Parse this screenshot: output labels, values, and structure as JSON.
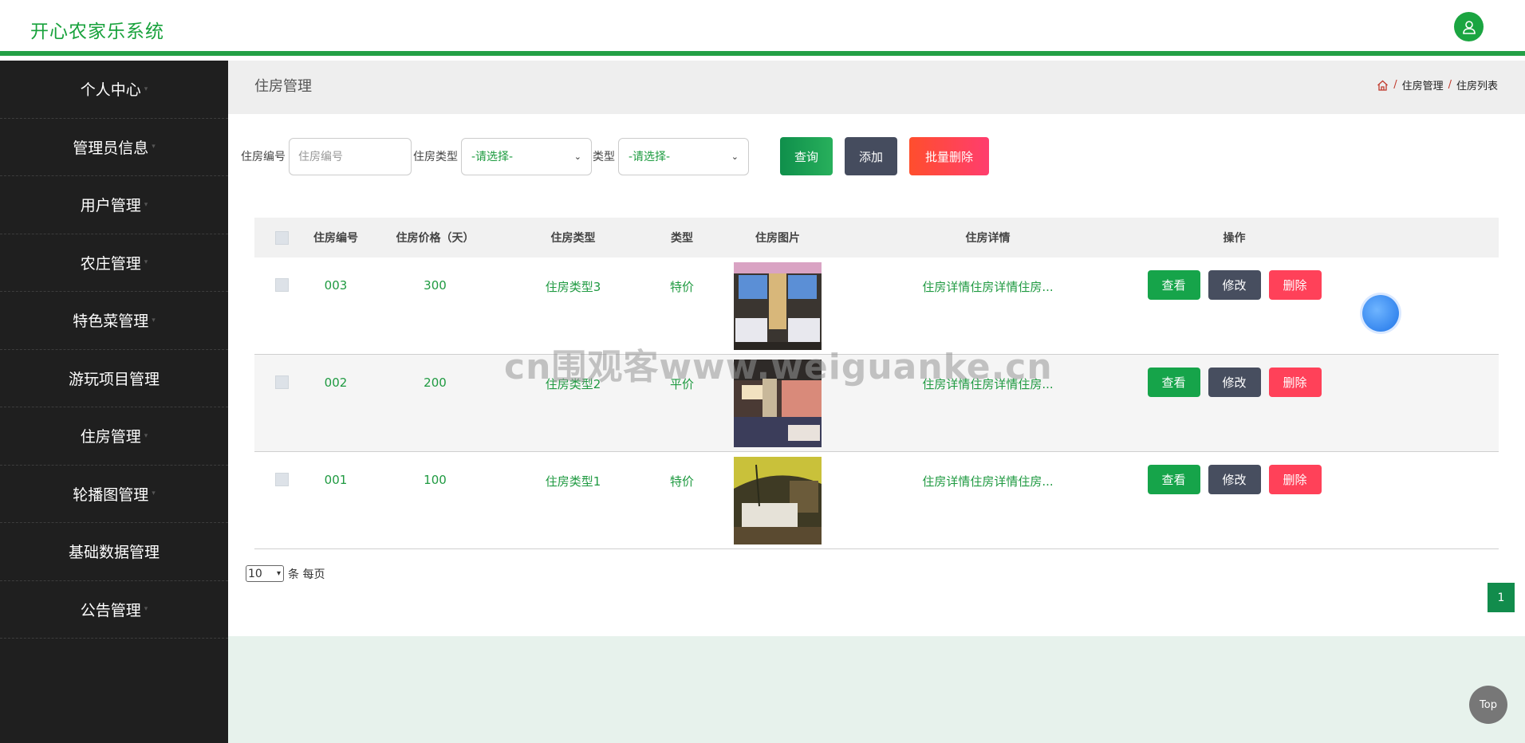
{
  "app": {
    "title": "开心农家乐系统"
  },
  "sidebar": {
    "items": [
      {
        "label": "个人中心",
        "caret": true
      },
      {
        "label": "管理员信息",
        "caret": true
      },
      {
        "label": "用户管理",
        "caret": true
      },
      {
        "label": "农庄管理",
        "caret": true
      },
      {
        "label": "特色菜管理",
        "caret": true
      },
      {
        "label": "游玩项目管理",
        "caret": false
      },
      {
        "label": "住房管理",
        "caret": true
      },
      {
        "label": "轮播图管理",
        "caret": true
      },
      {
        "label": "基础数据管理",
        "caret": false
      },
      {
        "label": "公告管理",
        "caret": true
      }
    ]
  },
  "page": {
    "title": "住房管理",
    "breadcrumb": [
      "住房管理",
      "住房列表"
    ]
  },
  "search": {
    "field1_label": "住房编号",
    "field1_placeholder": "住房编号",
    "field2_label": "住房类型",
    "field2_value": "-请选择-",
    "field3_label": "类型",
    "field3_value": "-请选择-",
    "query_label": "查询",
    "add_label": "添加",
    "batch_delete_label": "批量删除"
  },
  "table": {
    "headers": [
      "住房编号",
      "住房价格（天）",
      "住房类型",
      "类型",
      "住房图片",
      "住房详情",
      "操作"
    ],
    "rows": [
      {
        "code": "003",
        "price": "300",
        "room_type": "住房类型3",
        "kind": "特价",
        "detail": "住房详情住房详情住房..."
      },
      {
        "code": "002",
        "price": "200",
        "room_type": "住房类型2",
        "kind": "平价",
        "detail": "住房详情住房详情住房..."
      },
      {
        "code": "001",
        "price": "100",
        "room_type": "住房类型1",
        "kind": "特价",
        "detail": "住房详情住房详情住房..."
      }
    ],
    "view_label": "查看",
    "edit_label": "修改",
    "delete_label": "删除"
  },
  "pagination": {
    "page_size": "10",
    "per_page_text": "条 每页",
    "current_page": "1"
  },
  "top_button": "Top",
  "watermark": "cn围观客www.weiguanke.cn",
  "colors": {
    "brand": "#18a23c",
    "sidebar": "#1f1f1f",
    "view": "#16a44a",
    "edit": "#474e5f",
    "delete": "#ff4159"
  }
}
